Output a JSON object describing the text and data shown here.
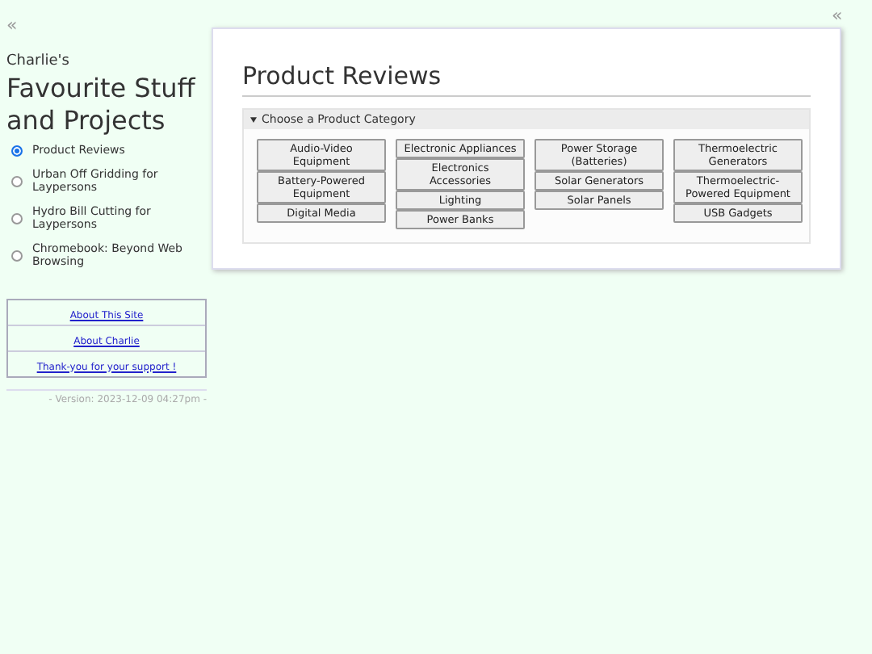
{
  "sidebar": {
    "collapse_glyph": "«",
    "subtitle": "Charlie's",
    "title": "Favourite Stuff and Projects",
    "nav": [
      {
        "label": "Product Reviews",
        "selected": true
      },
      {
        "label": "Urban Off Gridding for Laypersons",
        "selected": false
      },
      {
        "label": "Hydro Bill Cutting for Laypersons",
        "selected": false
      },
      {
        "label": "Chromebook: Beyond Web Browsing",
        "selected": false
      }
    ],
    "links": [
      "About This Site",
      "About Charlie",
      "Thank-you for your support !"
    ],
    "version": "- Version: 2023-12-09 04:27pm -"
  },
  "main": {
    "collapse_glyph": "«",
    "title": "Product Reviews",
    "category_panel": {
      "summary": "Choose a Product Category",
      "expanded": true,
      "columns": [
        [
          "Audio-Video Equipment",
          "Battery-Powered Equipment",
          "Digital Media"
        ],
        [
          "Electronic Appliances",
          "Electronics Accessories",
          "Lighting",
          "Power Banks"
        ],
        [
          "Power Storage (Batteries)",
          "Solar Generators",
          "Solar Panels"
        ],
        [
          "Thermoelectric Generators",
          "Thermoelectric-Powered Equipment",
          "USB Gadgets"
        ]
      ]
    }
  }
}
